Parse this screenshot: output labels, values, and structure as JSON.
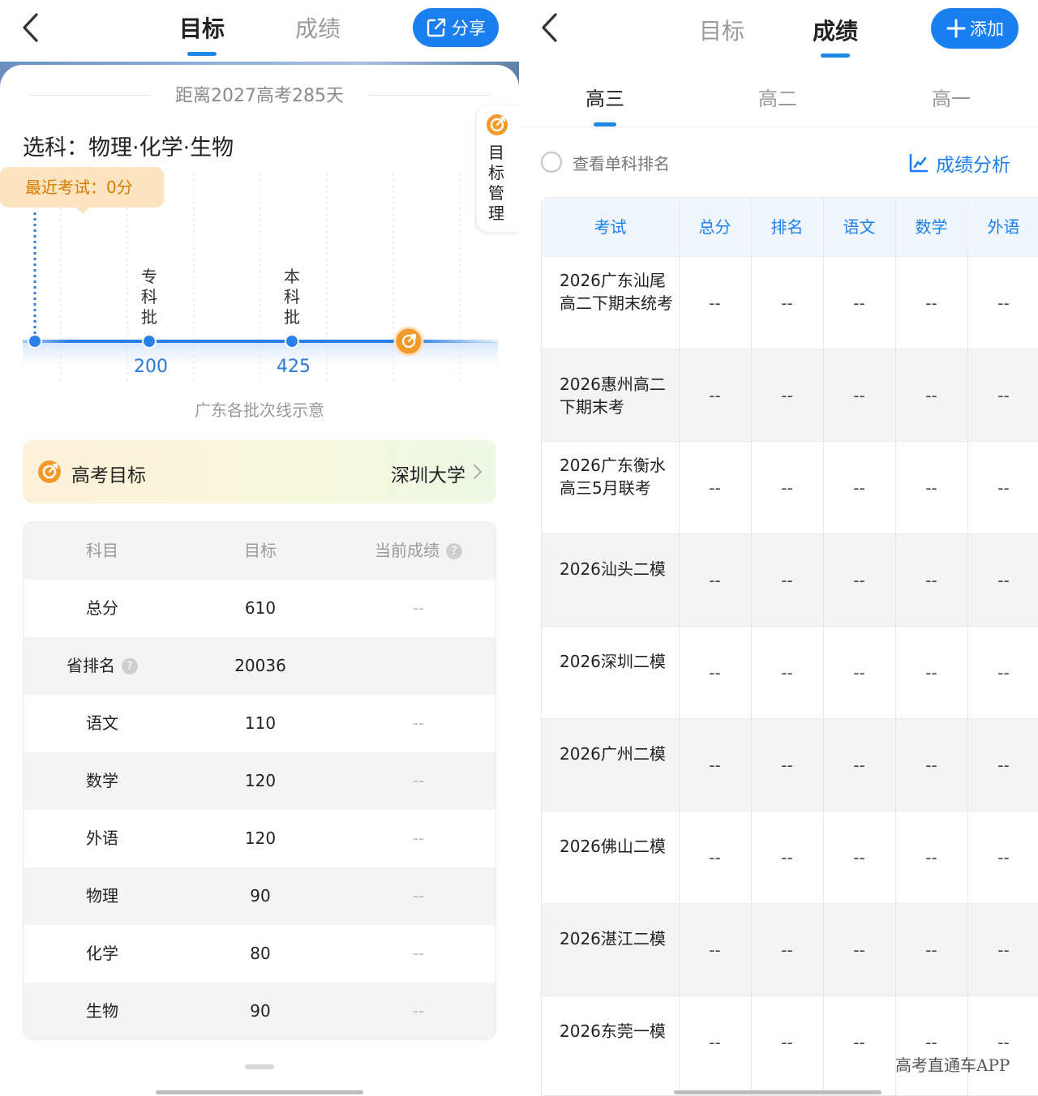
{
  "left": {
    "tabs": [
      {
        "label": "目标",
        "active": true
      },
      {
        "label": "成绩",
        "active": false
      }
    ],
    "share_label": "分享",
    "countdown": "距离2027高考285天",
    "subjects": "选科：物理·化学·生物",
    "side_tab_label": "目标管理",
    "recent_exam": "最近考试：0分",
    "batches": [
      {
        "label": "专科批",
        "score": "200"
      },
      {
        "label": "本科批",
        "score": "425"
      }
    ],
    "chart_caption": "广东各批次线示意",
    "goal": {
      "title": "高考目标",
      "school": "深圳大学"
    },
    "table": {
      "headers": [
        "科目",
        "目标",
        "当前成绩"
      ],
      "rows": [
        {
          "subject": "总分",
          "target": "610",
          "current": "--"
        },
        {
          "subject": "省排名",
          "target": "20036",
          "current": ""
        },
        {
          "subject": "语文",
          "target": "110",
          "current": "--"
        },
        {
          "subject": "数学",
          "target": "120",
          "current": "--"
        },
        {
          "subject": "外语",
          "target": "120",
          "current": "--"
        },
        {
          "subject": "物理",
          "target": "90",
          "current": "--"
        },
        {
          "subject": "化学",
          "target": "80",
          "current": "--"
        },
        {
          "subject": "生物",
          "target": "90",
          "current": "--"
        }
      ]
    }
  },
  "right": {
    "tabs": [
      {
        "label": "目标",
        "active": false
      },
      {
        "label": "成绩",
        "active": true
      }
    ],
    "add_label": "添加",
    "grades": [
      {
        "label": "高三",
        "active": true
      },
      {
        "label": "高二",
        "active": false
      },
      {
        "label": "高一",
        "active": false
      }
    ],
    "single_rank_label": "查看单科排名",
    "analysis_label": "成绩分析",
    "table": {
      "headers": [
        "考试",
        "总分",
        "排名",
        "语文",
        "数学",
        "外语"
      ],
      "rows": [
        {
          "name": "2026广东汕尾高二下期末统考",
          "cells": [
            "--",
            "--",
            "--",
            "--",
            "--"
          ]
        },
        {
          "name": "2026惠州高二下期末考",
          "cells": [
            "--",
            "--",
            "--",
            "--",
            "--"
          ]
        },
        {
          "name": "2026广东衡水高三5月联考",
          "cells": [
            "--",
            "--",
            "--",
            "--",
            "--"
          ]
        },
        {
          "name": "2026汕头二模",
          "cells": [
            "--",
            "--",
            "--",
            "--",
            "--"
          ]
        },
        {
          "name": "2026深圳二模",
          "cells": [
            "--",
            "--",
            "--",
            "--",
            "--"
          ]
        },
        {
          "name": "2026广州二模",
          "cells": [
            "--",
            "--",
            "--",
            "--",
            "--"
          ]
        },
        {
          "name": "2026佛山二模",
          "cells": [
            "--",
            "--",
            "--",
            "--",
            "--"
          ]
        },
        {
          "name": "2026湛江二模",
          "cells": [
            "--",
            "--",
            "--",
            "--",
            "--"
          ]
        },
        {
          "name": "2026东莞一模",
          "cells": [
            "--",
            "--",
            "--",
            "--",
            "--"
          ]
        }
      ]
    },
    "watermark": "高考直通车APP"
  },
  "colors": {
    "accent": "#1a7ff0",
    "warning": "#f39a2b",
    "bubble_bg": "#fbe4bf",
    "bubble_text": "#d97b00"
  },
  "icons": [
    "back-chevron-icon",
    "share-icon",
    "target-icon",
    "plus-icon",
    "chart-line-icon",
    "question-icon",
    "chevron-right-icon"
  ]
}
